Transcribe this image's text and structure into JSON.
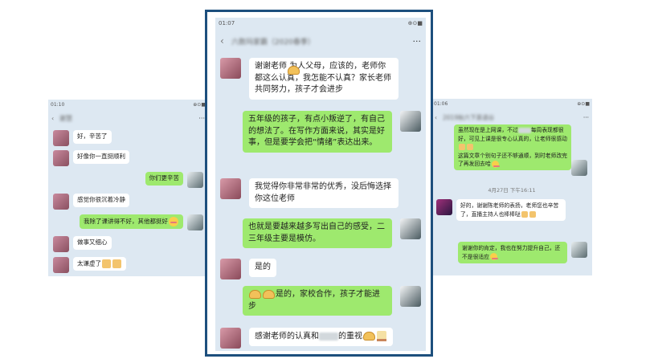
{
  "left_phone": {
    "status_time": "01:10",
    "status_icons": "⊕⊙■",
    "title": "谢慧",
    "menu": "···",
    "messages": [
      {
        "side": "left",
        "text": "好，辛苦了"
      },
      {
        "side": "left",
        "text": "好像你一直挺顺利"
      },
      {
        "side": "right",
        "text": "你们更辛苦"
      },
      {
        "side": "left",
        "text": "感觉你很沉着冷静"
      },
      {
        "side": "right",
        "text": "我除了课讲得不好，其他都挺好"
      },
      {
        "side": "left",
        "text": "做事又细心"
      },
      {
        "side": "left",
        "text": "太谦虚了"
      }
    ]
  },
  "center_phone": {
    "status_time": "01:07",
    "status_icons": "⊕⊙■",
    "title": "六数玛家霸（2020春季）",
    "menu": "···",
    "messages": [
      {
        "side": "left",
        "text": "谢谢老师    为人父母，应该的，老师你都这么认真，我怎能不认真？家长老师共同努力，孩子才会进步"
      },
      {
        "side": "right",
        "text": "五年级的孩子，有点小叛逆了，有自己的想法了。在写作方面来说，其实是好事，但是要学会把“情绪”表达出来。"
      },
      {
        "side": "left",
        "text": "我觉得你非常非常的优秀，没后悔选择你这位老师"
      },
      {
        "side": "right",
        "text": "也就是要越来越多写出自己的感受，二三年级主要是模仿。"
      },
      {
        "side": "left",
        "text": "是的"
      },
      {
        "side": "right",
        "text": "是的，家校合作，孩子才能进步"
      },
      {
        "side": "left",
        "text_before": "感谢老师的认真和",
        "text_after": "的重视"
      }
    ]
  },
  "right_phone": {
    "status_time": "01:06",
    "status_icons": "⊕⊙■",
    "title": "2019秋六下英语谷",
    "menu": "···",
    "top_message": {
      "text_a": "虽然现在是上网课，不过",
      "text_b": "每周表现都很好，可见上课是很专心认真的，让老师很感动",
      "text_c": "这篇文章个别句子还不够通顺，到时老师改完了再发回去哈"
    },
    "timestamp": "4月27日 下午16:11",
    "messages": [
      {
        "side": "left",
        "text": "好的，谢谢陈老师的表扬，老师您也辛苦了，直播主持人也棒棒哒"
      },
      {
        "side": "right",
        "text": "谢谢你的肯定，我也在努力提升自己，还不是很适应"
      }
    ]
  },
  "colors": {
    "chat_bg": "#dde8f2",
    "bubble_green": "#9ee96e",
    "bubble_white": "#ffffff",
    "frame_border": "#1d4f7d"
  }
}
